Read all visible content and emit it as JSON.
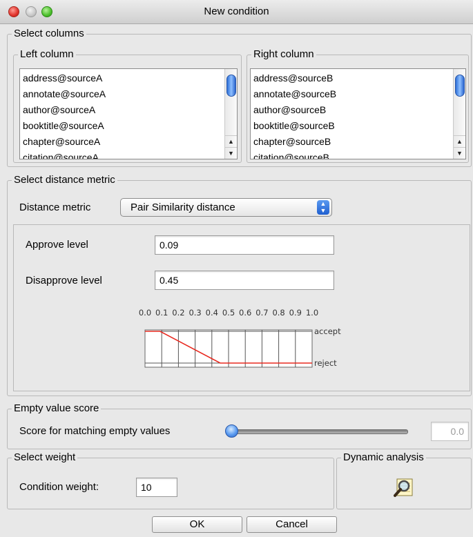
{
  "window": {
    "title": "New condition"
  },
  "select_columns": {
    "legend": "Select columns",
    "left": {
      "legend": "Left column",
      "items": [
        "address@sourceA",
        "annotate@sourceA",
        "author@sourceA",
        "booktitle@sourceA",
        "chapter@sourceA",
        "citation@sourceA"
      ]
    },
    "right": {
      "legend": "Right column",
      "items": [
        "address@sourceB",
        "annotate@sourceB",
        "author@sourceB",
        "booktitle@sourceB",
        "chapter@sourceB",
        "citation@sourceB"
      ]
    }
  },
  "distance": {
    "legend": "Select distance metric",
    "metric_label": "Distance metric",
    "metric_value": "Pair Similarity distance",
    "approve_label": "Approve level",
    "approve_value": "0.09",
    "disapprove_label": "Disapprove level",
    "disapprove_value": "0.45"
  },
  "chart_data": {
    "type": "line",
    "x_ticks": [
      "0.0",
      "0.1",
      "0.2",
      "0.3",
      "0.4",
      "0.5",
      "0.6",
      "0.7",
      "0.8",
      "0.9",
      "1.0"
    ],
    "xlim": [
      0,
      1
    ],
    "y_labels": [
      "accept",
      "reject"
    ],
    "series": [
      {
        "points": [
          [
            0,
            1
          ],
          [
            0.09,
            1
          ],
          [
            0.45,
            0
          ],
          [
            1.0,
            0
          ]
        ],
        "color": "#e8281e"
      }
    ],
    "grid": true
  },
  "empty_value": {
    "legend": "Empty value score",
    "label": "Score for matching empty values",
    "slider_value": 0.0,
    "value_text": "0.0"
  },
  "weight": {
    "legend": "Select weight",
    "label": "Condition weight:",
    "value": "10"
  },
  "dynamic": {
    "legend": "Dynamic analysis",
    "icon": "magnifier-icon"
  },
  "buttons": {
    "ok": "OK",
    "cancel": "Cancel"
  }
}
